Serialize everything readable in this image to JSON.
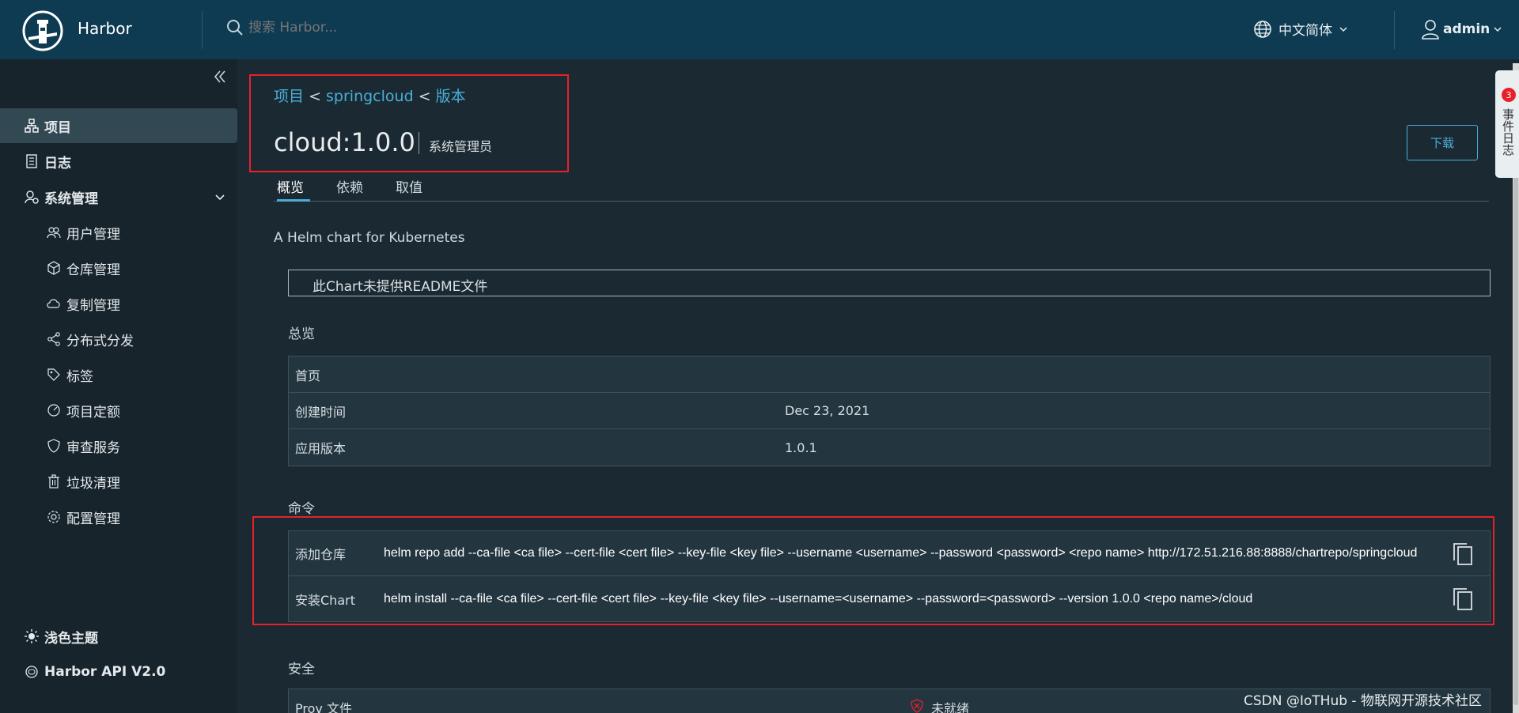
{
  "header": {
    "brand": "Harbor",
    "search_placeholder": "搜索 Harbor...",
    "language": "中文简体",
    "user": "admin"
  },
  "sidebar": {
    "items": [
      {
        "label": "项目",
        "icon": "project-icon",
        "level": "top"
      },
      {
        "label": "日志",
        "icon": "log-icon",
        "level": "top"
      },
      {
        "label": "系统管理",
        "icon": "admin-icon",
        "level": "top"
      },
      {
        "label": "用户管理",
        "icon": "users-icon",
        "level": "sub"
      },
      {
        "label": "仓库管理",
        "icon": "registry-icon",
        "level": "sub"
      },
      {
        "label": "复制管理",
        "icon": "cloud-icon",
        "level": "sub"
      },
      {
        "label": "分布式分发",
        "icon": "share-icon",
        "level": "sub"
      },
      {
        "label": "标签",
        "icon": "tag-icon",
        "level": "sub"
      },
      {
        "label": "项目定额",
        "icon": "quota-icon",
        "level": "sub"
      },
      {
        "label": "审查服务",
        "icon": "shield-icon",
        "level": "sub"
      },
      {
        "label": "垃圾清理",
        "icon": "trash-icon",
        "level": "sub"
      },
      {
        "label": "配置管理",
        "icon": "gear-icon",
        "level": "sub"
      }
    ],
    "theme": "浅色主题",
    "api": "Harbor API V2.0"
  },
  "breadcrumb": {
    "project": "项目",
    "repo": "springcloud",
    "version": "版本",
    "sep": "<"
  },
  "title": "cloud:1.0.0",
  "role": "系统管理员",
  "download_label": "下载",
  "tabs": [
    "概览",
    "依赖",
    "取值"
  ],
  "description": "A Helm chart for Kubernetes",
  "readme": "此Chart未提供README文件",
  "overview": {
    "label": "总览",
    "home": "首页",
    "created_label": "创建时间",
    "created_value": "Dec 23, 2021",
    "app_version_label": "应用版本",
    "app_version_value": "1.0.1"
  },
  "commands": {
    "label": "命令",
    "add_repo_label": "添加仓库",
    "add_repo_cmd": "helm repo add --ca-file <ca file> --cert-file <cert file> --key-file <key file>     --username <username> --password <password> <repo name> http://172.51.216.88:8888/chartrepo/springcloud",
    "install_label": "安装Chart",
    "install_cmd": "helm install --ca-file <ca file> --cert-file <cert file> --key-file <key file>     --username=<username> --password=<password> --version 1.0.0 <repo name>/cloud"
  },
  "security": {
    "label": "安全",
    "prov_label": "Prov 文件",
    "prov_status": "未就绪"
  },
  "right_strip": {
    "badge": "3",
    "text": "事件日志"
  },
  "watermark": "CSDN @IoTHub - 物联网开源技术社区",
  "colors": {
    "header_bg": "#0f3b52",
    "sidebar_bg": "#17242b",
    "main_bg": "#1b2a32",
    "link": "#49afd9",
    "highlight_red": "#e8202a"
  }
}
